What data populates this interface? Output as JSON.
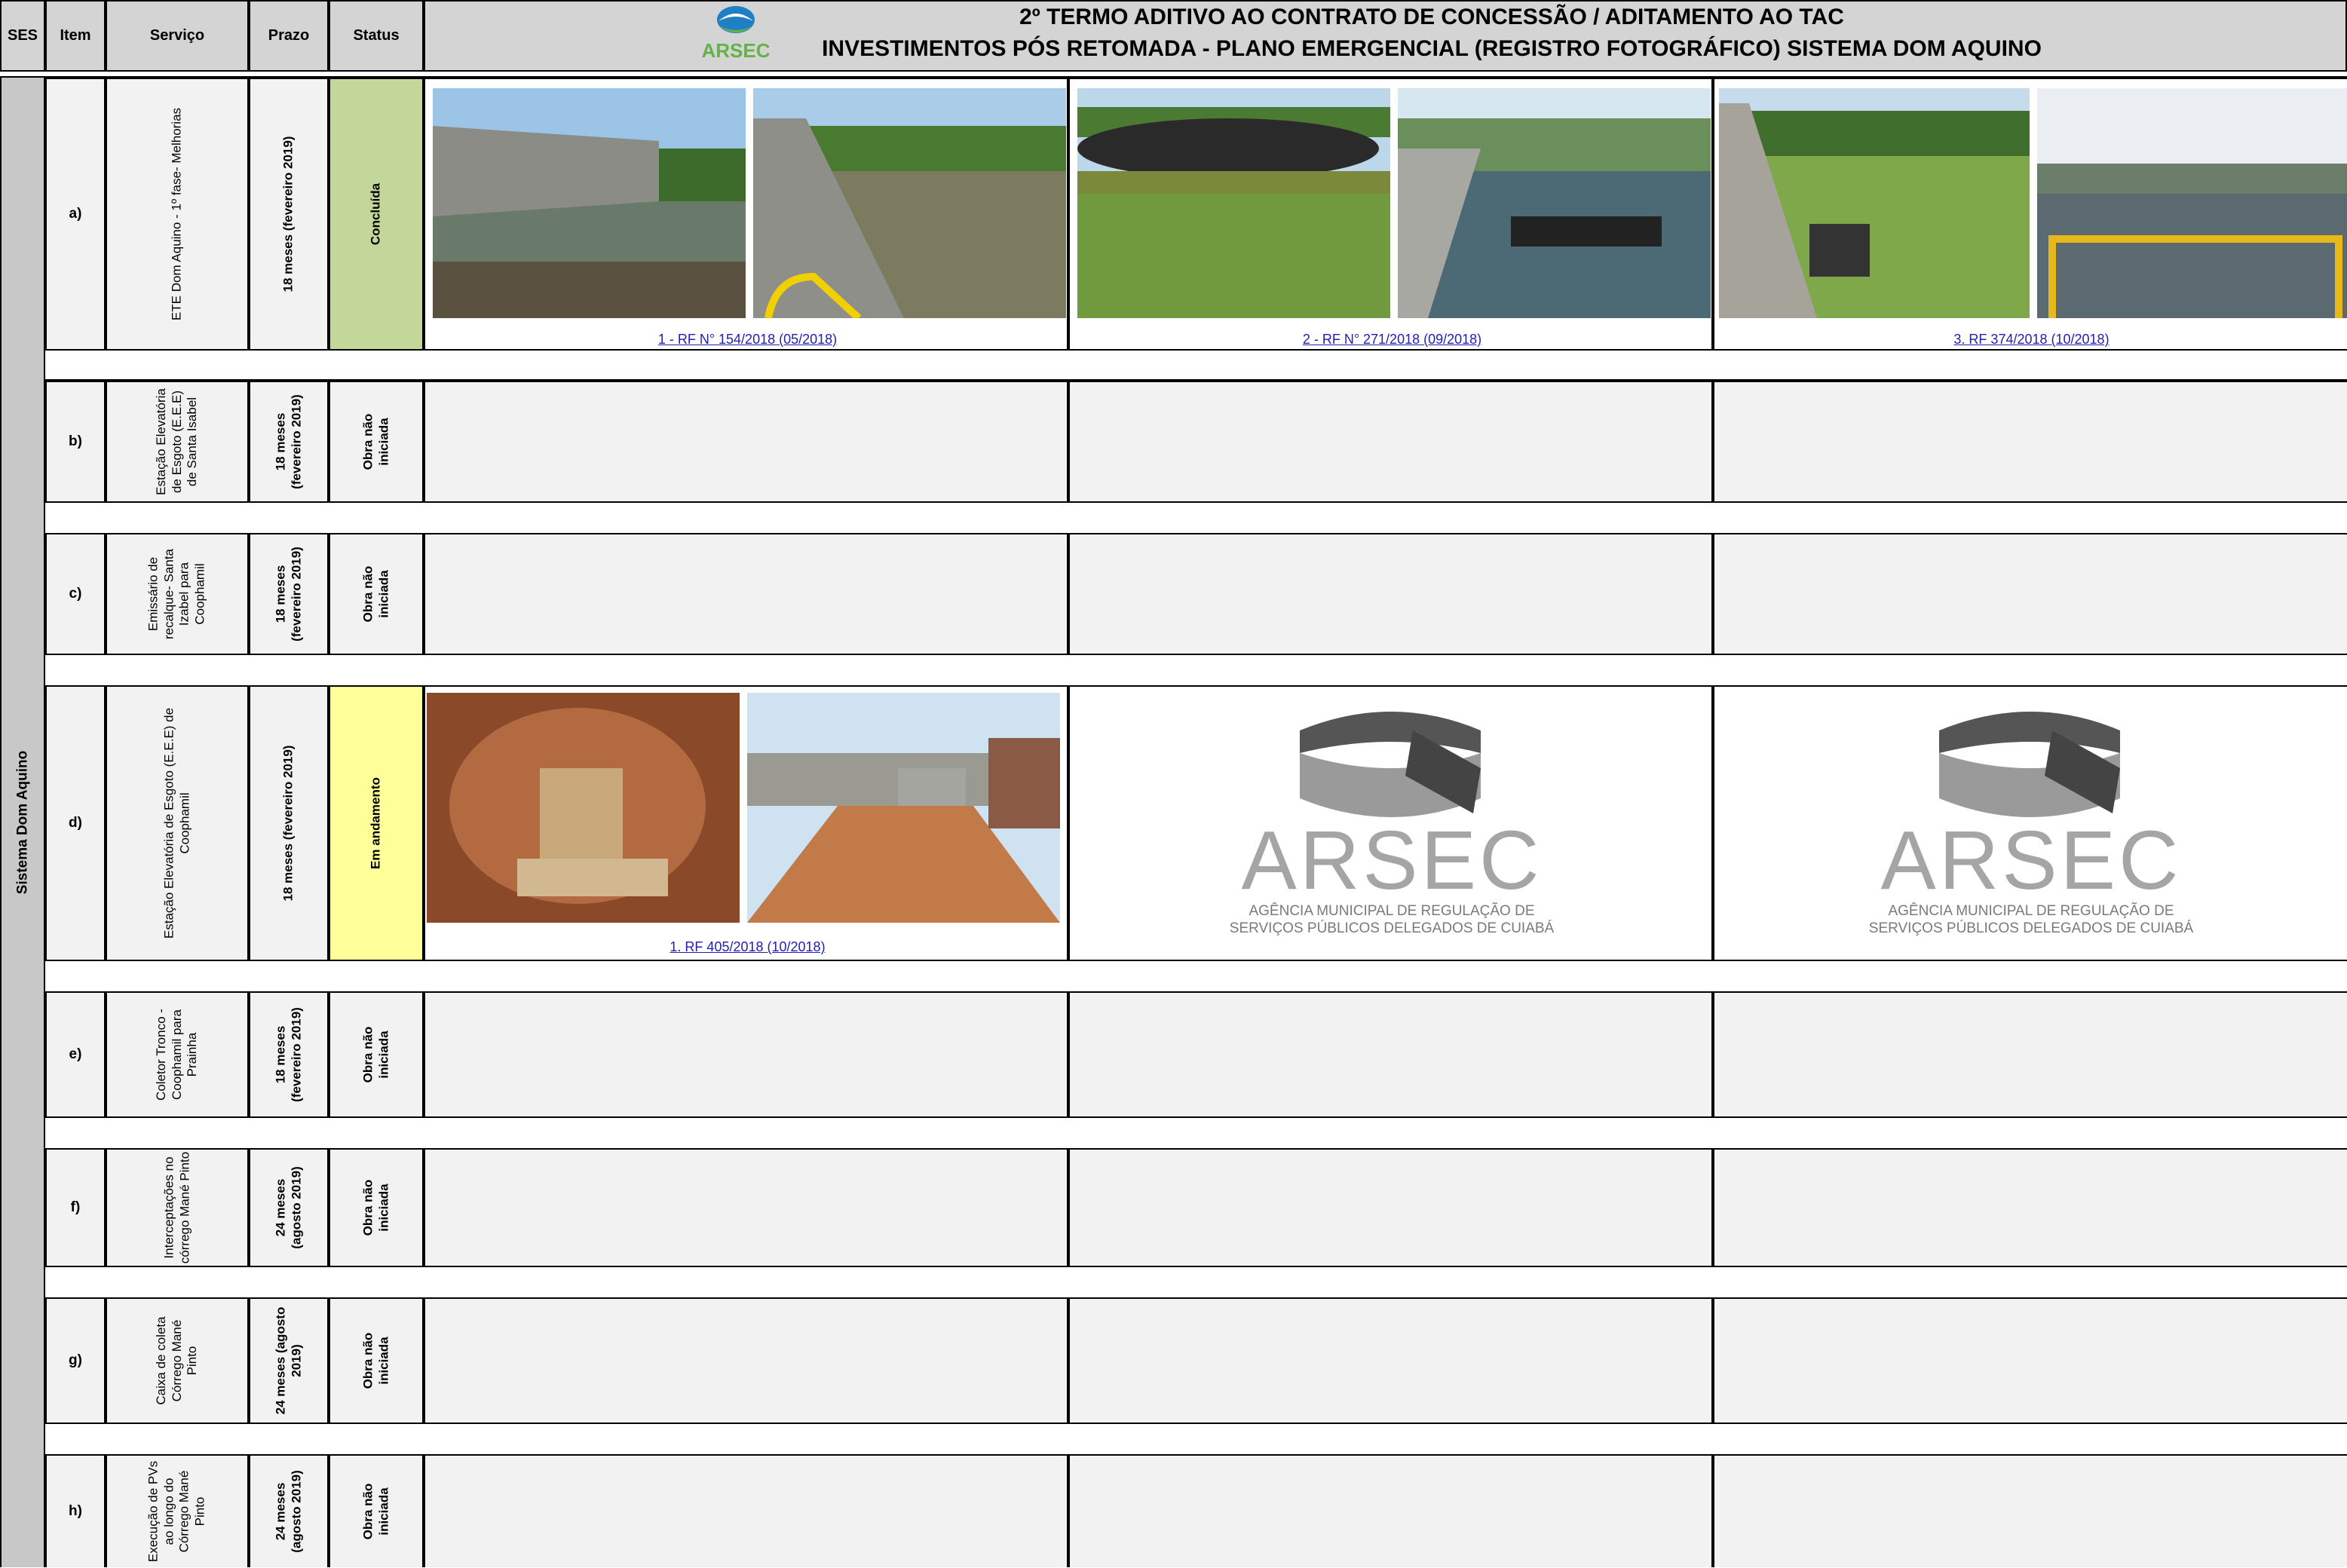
{
  "header": {
    "col_ses": "SES",
    "col_item": "Item",
    "col_servico": "Serviço",
    "col_prazo": "Prazo",
    "col_status": "Status",
    "title_line1": "2º TERMO ADITIVO AO CONTRATO DE CONCESSÃO / ADITAMENTO AO TAC",
    "title_line2": "INVESTIMENTOS PÓS RETOMADA - PLANO EMERGENCIAL (REGISTRO FOTOGRÁFICO) SISTEMA DOM  AQUINO",
    "logo_text": "ARSEC"
  },
  "ses_label": "Sistema Dom Aquino",
  "rows": [
    {
      "item": "a)",
      "servico": "ETE Dom Aquino - 1º fase- Melhorias",
      "prazo": "18 meses (fevereiro 2019)",
      "status": "Concluída",
      "status_color": "#c4d79b"
    },
    {
      "item": "b)",
      "servico": "Estação Elevatória de Esgoto (E.E.E) de Santa Isabel",
      "prazo": "18 meses (fevereiro 2019)",
      "status": "Obra não iniciada",
      "status_color": "#f2f2f2"
    },
    {
      "item": "c)",
      "servico": "Emissário de recalque- Santa Izabel para Coophamil",
      "prazo": "18 meses (fevereiro 2019)",
      "status": "Obra não iniciada",
      "status_color": "#f2f2f2"
    },
    {
      "item": "d)",
      "servico": "Estação Elevatória de Esgoto (E.E.E) de Coophamil",
      "prazo": "18 meses (fevereiro 2019)",
      "status": "Em andamento",
      "status_color": "#ffff99"
    },
    {
      "item": "e)",
      "servico": "Coletor Tronco - Coophamil para Prainha",
      "prazo": "18 meses (fevereiro 2019)",
      "status": "Obra não iniciada",
      "status_color": "#f2f2f2"
    },
    {
      "item": "f)",
      "servico": "Interceptações no córrego Mané Pinto",
      "prazo": "24 meses (agosto 2019)",
      "status": "Obra não iniciada",
      "status_color": "#f2f2f2"
    },
    {
      "item": "g)",
      "servico": "Caixa de coleta Córrego Mané Pinto",
      "prazo": "24 meses (agosto 2019)",
      "status": "Obra não iniciada",
      "status_color": "#f2f2f2"
    },
    {
      "item": "h)",
      "servico": "Execução de PVs ao longo do Córrego Mané Pinto",
      "prazo": "24 meses (agosto 2019)",
      "status": "Obra não iniciada",
      "status_color": "#f2f2f2"
    }
  ],
  "captions": {
    "a1": "1 - RF N° 154/2018 (05/2018)",
    "a2": "2 - RF N° 271/2018 (09/2018)",
    "a3": "3. RF 374/2018 (10/2018)",
    "d1": "1. RF 405/2018 (10/2018)"
  },
  "placeholder_logo": {
    "name": "ARSEC",
    "line1": "AGÊNCIA MUNICIPAL DE REGULAÇÃO DE",
    "line2": "SERVIÇOS PÚBLICOS DELEGADOS DE CUIABÁ"
  }
}
